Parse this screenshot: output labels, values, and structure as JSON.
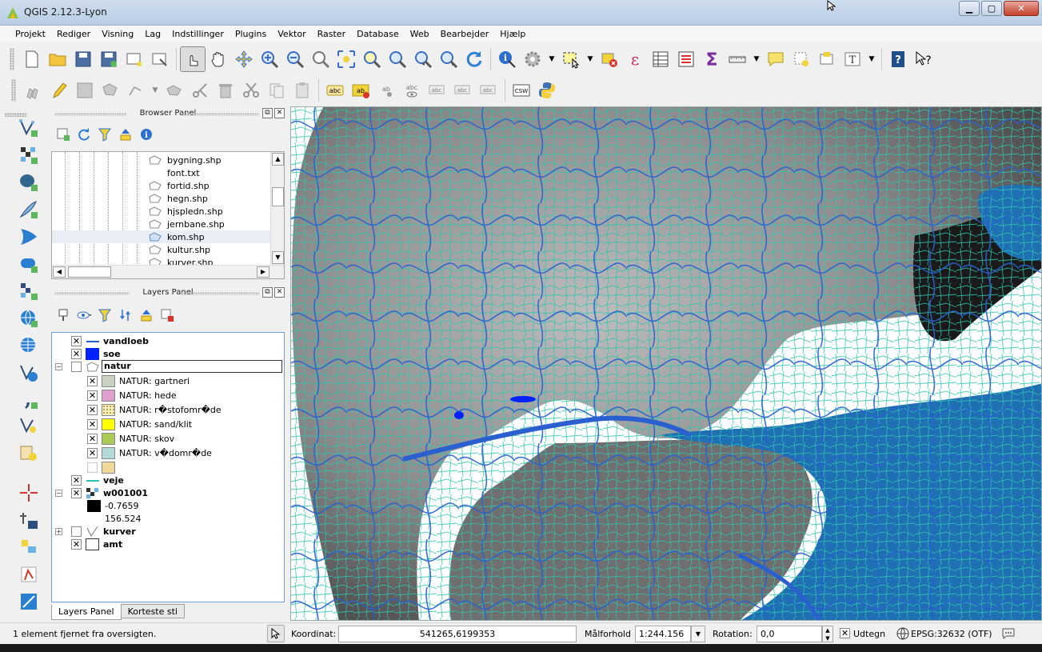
{
  "window": {
    "title": "QGIS 2.12.3-Lyon",
    "minimize_icon": "minimize-icon",
    "maximize_icon": "maximize-icon",
    "close_icon": "close-icon"
  },
  "menu": [
    "Projekt",
    "Rediger",
    "Visning",
    "Lag",
    "Indstillinger",
    "Plugins",
    "Vektor",
    "Raster",
    "Database",
    "Web",
    "Bearbejder",
    "Hjælp"
  ],
  "browser_panel": {
    "title": "Browser Panel",
    "files": [
      "bygning.shp",
      "font.txt",
      "fortid.shp",
      "hegn.shp",
      "hjspledn.shp",
      "jernbane.shp",
      "kom.shp",
      "kultur.shp",
      "kurver.shp"
    ],
    "selected": "kom.shp"
  },
  "layers_panel": {
    "title": "Layers Panel",
    "layers": {
      "vandloeb": "vandloeb",
      "soe": "soe",
      "natur": "natur",
      "natur_items": [
        "NATUR: gartneri",
        "NATUR: hede",
        "NATUR: r�stofomr�de",
        "NATUR: sand/klit",
        "NATUR: skov",
        "NATUR: v�domr�de"
      ],
      "veje": "veje",
      "w001001": "w001001",
      "w_min": "-0.7659",
      "w_max": "156.524",
      "kurver": "kurver",
      "amt": "amt"
    },
    "tabs": [
      "Layers Panel",
      "Korteste sti"
    ]
  },
  "colors": {
    "water": "#1f6fb3",
    "rivers": "#2a5fd0",
    "roads": "#2ec4b0",
    "soe": "#0022ff",
    "natur_swatches": [
      "#c7d3c0",
      "#e0a0cf",
      "#f6ecb8",
      "#ffff00",
      "#aacc55",
      "#b3dad8",
      "#f0d89a"
    ]
  },
  "status": {
    "message": "1 element fjernet fra oversigten.",
    "coord_label": "Koordinat:",
    "coord_value": "541265,6199353",
    "scale_label": "Målforhold",
    "scale_value": "1:244.156",
    "rotation_label": "Rotation:",
    "rotation_value": "0,0",
    "render_label": "Udtegn",
    "crs": "EPSG:32632 (OTF)"
  }
}
